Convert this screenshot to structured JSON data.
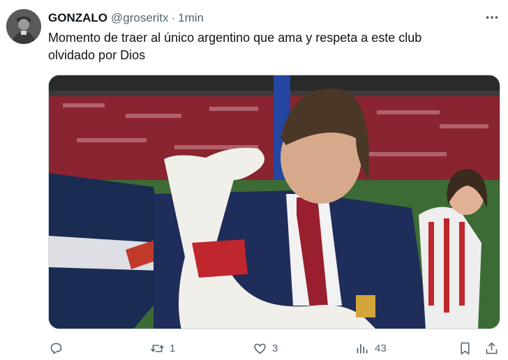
{
  "post": {
    "author_name": "GONZALO",
    "author_handle": "@groseritx",
    "separator": "·",
    "time_ago": "1min",
    "text_line1": "Momento de traer al único argentino que ama y respeta a este club",
    "text_line2": "olvidado por Dios"
  },
  "actions": {
    "reply_count": "",
    "repost_count": "1",
    "like_count": "3",
    "views_count": "43"
  },
  "icons": {
    "more": "more-horizontal-icon",
    "reply": "reply-icon",
    "repost": "repost-icon",
    "like": "heart-icon",
    "views": "views-icon",
    "bookmark": "bookmark-icon",
    "share": "share-icon"
  },
  "colors": {
    "text_primary": "#0f1419",
    "text_secondary": "#536471",
    "border": "#cfd9de"
  }
}
